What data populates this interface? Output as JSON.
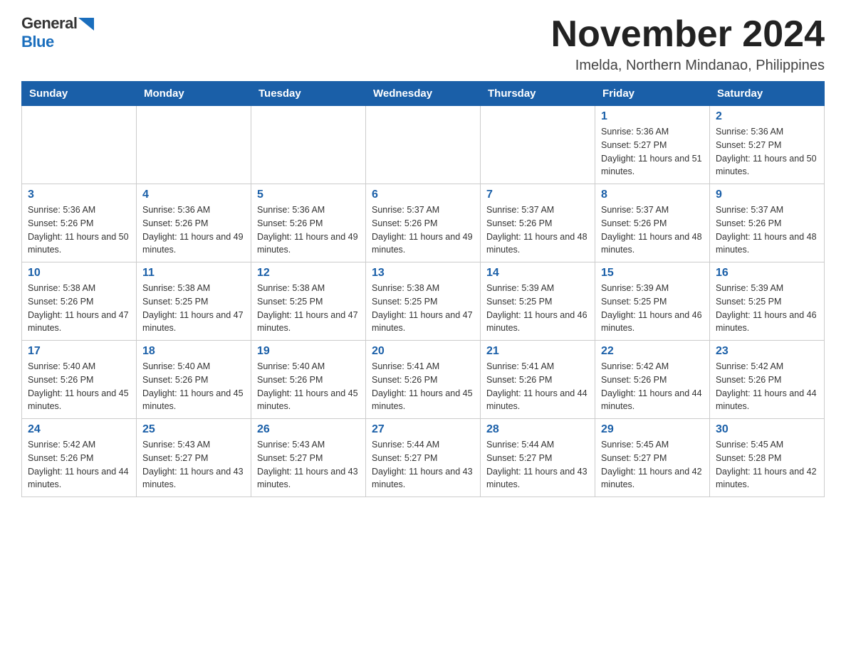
{
  "logo": {
    "general": "General",
    "blue": "Blue"
  },
  "title": {
    "month_year": "November 2024",
    "location": "Imelda, Northern Mindanao, Philippines"
  },
  "weekdays": [
    "Sunday",
    "Monday",
    "Tuesday",
    "Wednesday",
    "Thursday",
    "Friday",
    "Saturday"
  ],
  "weeks": [
    [
      {
        "day": "",
        "info": ""
      },
      {
        "day": "",
        "info": ""
      },
      {
        "day": "",
        "info": ""
      },
      {
        "day": "",
        "info": ""
      },
      {
        "day": "",
        "info": ""
      },
      {
        "day": "1",
        "info": "Sunrise: 5:36 AM\nSunset: 5:27 PM\nDaylight: 11 hours and 51 minutes."
      },
      {
        "day": "2",
        "info": "Sunrise: 5:36 AM\nSunset: 5:27 PM\nDaylight: 11 hours and 50 minutes."
      }
    ],
    [
      {
        "day": "3",
        "info": "Sunrise: 5:36 AM\nSunset: 5:26 PM\nDaylight: 11 hours and 50 minutes."
      },
      {
        "day": "4",
        "info": "Sunrise: 5:36 AM\nSunset: 5:26 PM\nDaylight: 11 hours and 49 minutes."
      },
      {
        "day": "5",
        "info": "Sunrise: 5:36 AM\nSunset: 5:26 PM\nDaylight: 11 hours and 49 minutes."
      },
      {
        "day": "6",
        "info": "Sunrise: 5:37 AM\nSunset: 5:26 PM\nDaylight: 11 hours and 49 minutes."
      },
      {
        "day": "7",
        "info": "Sunrise: 5:37 AM\nSunset: 5:26 PM\nDaylight: 11 hours and 48 minutes."
      },
      {
        "day": "8",
        "info": "Sunrise: 5:37 AM\nSunset: 5:26 PM\nDaylight: 11 hours and 48 minutes."
      },
      {
        "day": "9",
        "info": "Sunrise: 5:37 AM\nSunset: 5:26 PM\nDaylight: 11 hours and 48 minutes."
      }
    ],
    [
      {
        "day": "10",
        "info": "Sunrise: 5:38 AM\nSunset: 5:26 PM\nDaylight: 11 hours and 47 minutes."
      },
      {
        "day": "11",
        "info": "Sunrise: 5:38 AM\nSunset: 5:25 PM\nDaylight: 11 hours and 47 minutes."
      },
      {
        "day": "12",
        "info": "Sunrise: 5:38 AM\nSunset: 5:25 PM\nDaylight: 11 hours and 47 minutes."
      },
      {
        "day": "13",
        "info": "Sunrise: 5:38 AM\nSunset: 5:25 PM\nDaylight: 11 hours and 47 minutes."
      },
      {
        "day": "14",
        "info": "Sunrise: 5:39 AM\nSunset: 5:25 PM\nDaylight: 11 hours and 46 minutes."
      },
      {
        "day": "15",
        "info": "Sunrise: 5:39 AM\nSunset: 5:25 PM\nDaylight: 11 hours and 46 minutes."
      },
      {
        "day": "16",
        "info": "Sunrise: 5:39 AM\nSunset: 5:25 PM\nDaylight: 11 hours and 46 minutes."
      }
    ],
    [
      {
        "day": "17",
        "info": "Sunrise: 5:40 AM\nSunset: 5:26 PM\nDaylight: 11 hours and 45 minutes."
      },
      {
        "day": "18",
        "info": "Sunrise: 5:40 AM\nSunset: 5:26 PM\nDaylight: 11 hours and 45 minutes."
      },
      {
        "day": "19",
        "info": "Sunrise: 5:40 AM\nSunset: 5:26 PM\nDaylight: 11 hours and 45 minutes."
      },
      {
        "day": "20",
        "info": "Sunrise: 5:41 AM\nSunset: 5:26 PM\nDaylight: 11 hours and 45 minutes."
      },
      {
        "day": "21",
        "info": "Sunrise: 5:41 AM\nSunset: 5:26 PM\nDaylight: 11 hours and 44 minutes."
      },
      {
        "day": "22",
        "info": "Sunrise: 5:42 AM\nSunset: 5:26 PM\nDaylight: 11 hours and 44 minutes."
      },
      {
        "day": "23",
        "info": "Sunrise: 5:42 AM\nSunset: 5:26 PM\nDaylight: 11 hours and 44 minutes."
      }
    ],
    [
      {
        "day": "24",
        "info": "Sunrise: 5:42 AM\nSunset: 5:26 PM\nDaylight: 11 hours and 44 minutes."
      },
      {
        "day": "25",
        "info": "Sunrise: 5:43 AM\nSunset: 5:27 PM\nDaylight: 11 hours and 43 minutes."
      },
      {
        "day": "26",
        "info": "Sunrise: 5:43 AM\nSunset: 5:27 PM\nDaylight: 11 hours and 43 minutes."
      },
      {
        "day": "27",
        "info": "Sunrise: 5:44 AM\nSunset: 5:27 PM\nDaylight: 11 hours and 43 minutes."
      },
      {
        "day": "28",
        "info": "Sunrise: 5:44 AM\nSunset: 5:27 PM\nDaylight: 11 hours and 43 minutes."
      },
      {
        "day": "29",
        "info": "Sunrise: 5:45 AM\nSunset: 5:27 PM\nDaylight: 11 hours and 42 minutes."
      },
      {
        "day": "30",
        "info": "Sunrise: 5:45 AM\nSunset: 5:28 PM\nDaylight: 11 hours and 42 minutes."
      }
    ]
  ]
}
